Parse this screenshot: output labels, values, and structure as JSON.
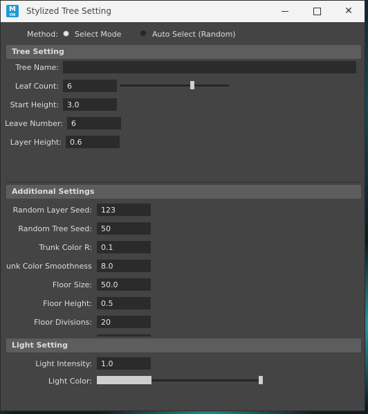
{
  "window": {
    "title": "Stylized Tree Setting",
    "app_icon_letter": "M",
    "app_icon_sub": "ON"
  },
  "method": {
    "label": "Method:",
    "options": [
      "Select Mode",
      "Auto Select (Random)"
    ],
    "selected": "Select Mode"
  },
  "tree_setting": {
    "header": "Tree Setting",
    "tree_name": {
      "label": "Tree Name:",
      "value": ""
    },
    "leaf_count": {
      "label": "Leaf Count:",
      "value": "6",
      "slider_fraction": 0.66
    },
    "start_height": {
      "label": "Start Height:",
      "value": "3.0"
    },
    "leave_number": {
      "label": "Leave Number:",
      "value": "6"
    },
    "layer_height": {
      "label": "Layer Height:",
      "value": "0.6"
    }
  },
  "additional_settings": {
    "header": "Additional Settings",
    "fields": [
      {
        "label": "Random Layer Seed:",
        "value": "123"
      },
      {
        "label": "Random Tree Seed:",
        "value": "50"
      },
      {
        "label": "Trunk Color R:",
        "value": "0.1"
      },
      {
        "label": "unk Color Smoothness:",
        "value": "8.0"
      },
      {
        "label": "Floor Size:",
        "value": "50.0"
      },
      {
        "label": "Floor Height:",
        "value": "0.5"
      },
      {
        "label": "Floor Divisions:",
        "value": "20"
      }
    ]
  },
  "light_setting": {
    "header": "Light Setting",
    "light_intensity": {
      "label": "Light Intensity:",
      "value": "1.0"
    },
    "light_color": {
      "label": "Light Color:",
      "slider_fraction": 1.0,
      "swatch": "#cfcfcf"
    }
  },
  "colors": {
    "window_bg": "#444444",
    "field_bg": "#2b2b2b",
    "header_bg": "#5d5d5d",
    "titlebar_bg": "#f3f3f3",
    "accent_glow": "#28d2dc"
  }
}
